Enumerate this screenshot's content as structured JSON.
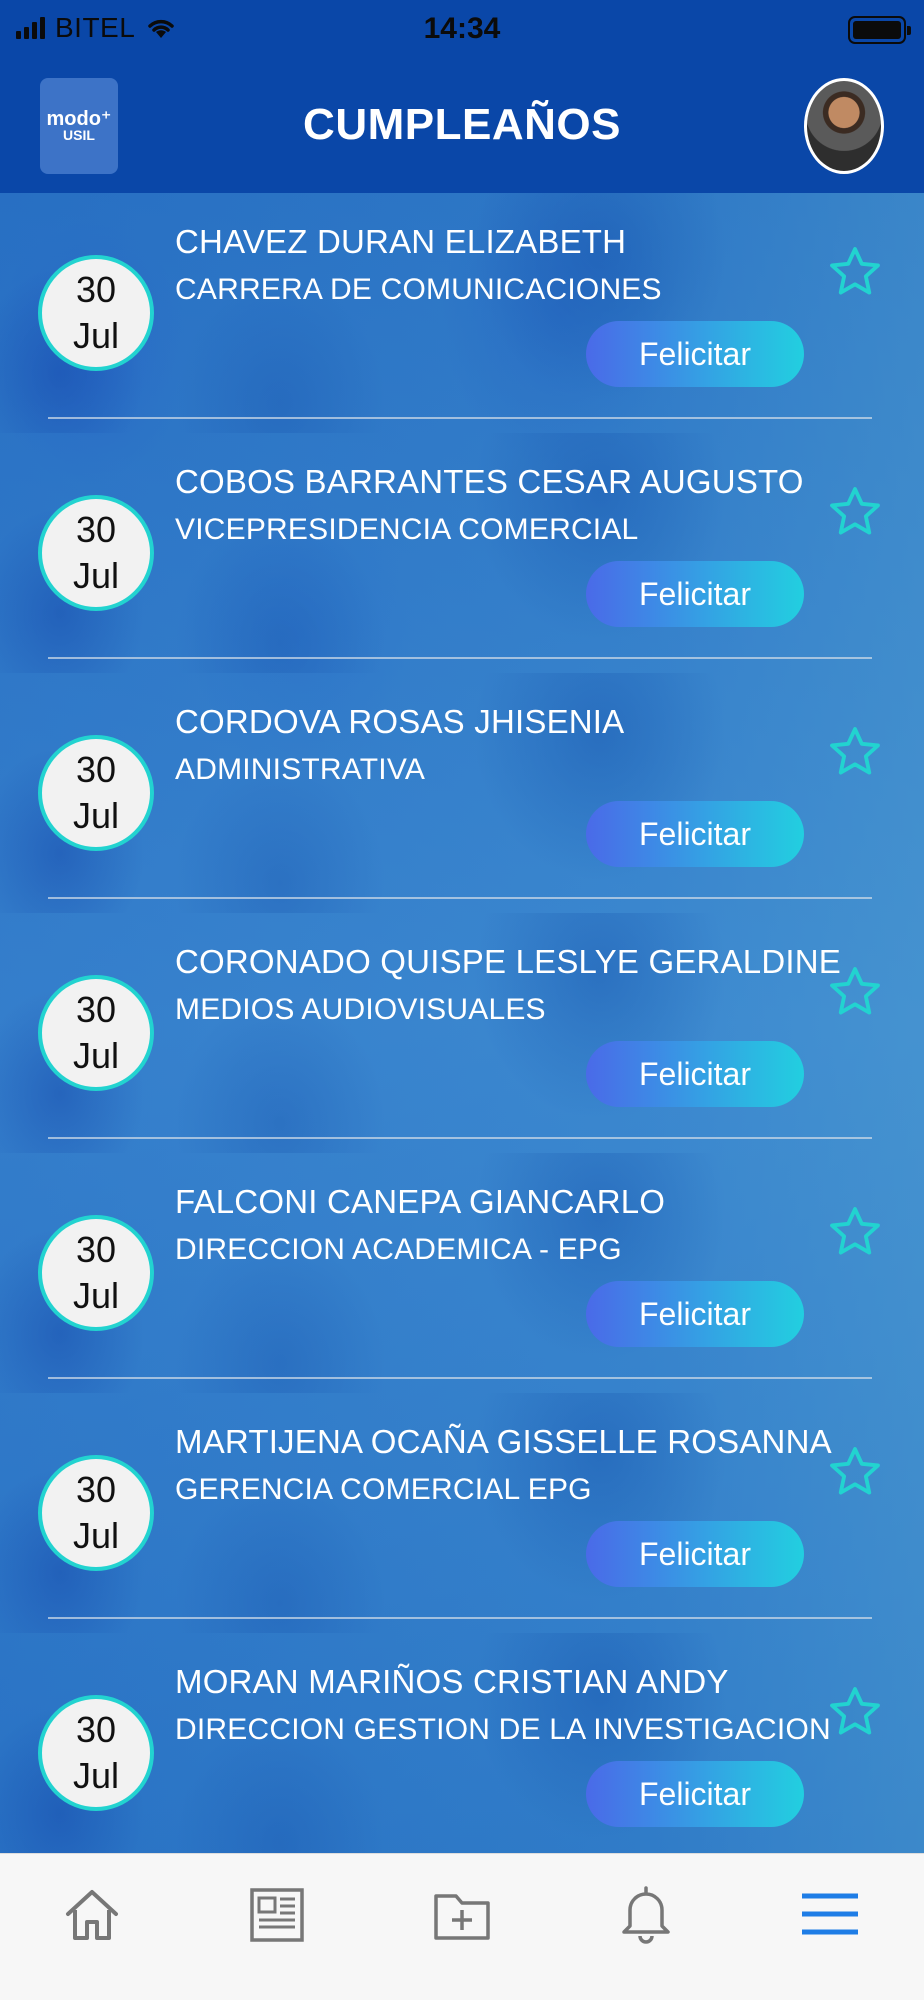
{
  "status": {
    "carrier": "BITEL",
    "time": "14:34"
  },
  "header": {
    "title": "CUMPLEAÑOS",
    "logo_line1": "modo⁺",
    "logo_line2": "USIL"
  },
  "birthdays": [
    {
      "day": "30",
      "month": "Jul",
      "name": "CHAVEZ DURAN ELIZABETH",
      "dept": " CARRERA DE COMUNICACIONES",
      "button": "Felicitar"
    },
    {
      "day": "30",
      "month": "Jul",
      "name": "COBOS BARRANTES CESAR AUGUSTO",
      "dept": "VICEPRESIDENCIA COMERCIAL",
      "button": "Felicitar"
    },
    {
      "day": "30",
      "month": "Jul",
      "name": "CORDOVA ROSAS JHISENIA",
      "dept": "ADMINISTRATIVA",
      "button": "Felicitar"
    },
    {
      "day": "30",
      "month": "Jul",
      "name": "CORONADO QUISPE LESLYE GERALDINE",
      "dept": "MEDIOS AUDIOVISUALES",
      "button": "Felicitar"
    },
    {
      "day": "30",
      "month": "Jul",
      "name": "FALCONI CANEPA GIANCARLO",
      "dept": "DIRECCION ACADEMICA - EPG",
      "button": "Felicitar"
    },
    {
      "day": "30",
      "month": "Jul",
      "name": "MARTIJENA OCAÑA GISSELLE ROSANNA",
      "dept": "GERENCIA COMERCIAL EPG",
      "button": "Felicitar"
    },
    {
      "day": "30",
      "month": "Jul",
      "name": "MORAN MARIÑOS CRISTIAN ANDY",
      "dept": "DIRECCION GESTION DE LA INVESTIGACION",
      "button": "Felicitar"
    }
  ],
  "nav": {
    "items": [
      {
        "icon": "home-icon"
      },
      {
        "icon": "news-icon"
      },
      {
        "icon": "folder-add-icon"
      },
      {
        "icon": "bell-icon"
      },
      {
        "icon": "menu-icon",
        "active": true
      }
    ]
  },
  "colors": {
    "header_bg": "#0a47a8",
    "accent_cyan": "#22d3d0",
    "button_start": "#4a6ae8",
    "button_end": "#22cfe0",
    "menu_active": "#1e7de6"
  }
}
